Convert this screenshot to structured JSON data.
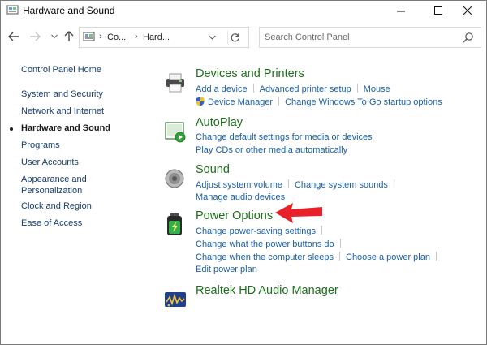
{
  "window": {
    "title": "Hardware and Sound"
  },
  "address": {
    "crumbs": [
      "Co...",
      "Hard..."
    ],
    "search_placeholder": "Search Control Panel"
  },
  "sidebar": {
    "items": [
      {
        "label": "Control Panel Home",
        "active": false
      },
      {
        "label": "System and Security",
        "active": false
      },
      {
        "label": "Network and Internet",
        "active": false
      },
      {
        "label": "Hardware and Sound",
        "active": true
      },
      {
        "label": "Programs",
        "active": false
      },
      {
        "label": "User Accounts",
        "active": false
      },
      {
        "label": "Appearance and",
        "label2": "Personalization",
        "active": false
      },
      {
        "label": "Clock and Region",
        "active": false
      },
      {
        "label": "Ease of Access",
        "active": false
      }
    ]
  },
  "sections": {
    "devices": {
      "title": "Devices and Printers",
      "links": [
        "Add a device",
        "Advanced printer setup",
        "Mouse",
        "Device Manager",
        "Change Windows To Go startup options"
      ]
    },
    "autoplay": {
      "title": "AutoPlay",
      "links": [
        "Change default settings for media or devices",
        "Play CDs or other media automatically"
      ]
    },
    "sound": {
      "title": "Sound",
      "links": [
        "Adjust system volume",
        "Change system sounds",
        "Manage audio devices"
      ]
    },
    "power": {
      "title": "Power Options",
      "links": [
        "Change power-saving settings",
        "Change what the power buttons do",
        "Change when the computer sleeps",
        "Choose a power plan",
        "Edit power plan"
      ]
    },
    "realtek": {
      "title": "Realtek HD Audio Manager"
    }
  },
  "colors": {
    "section_title": "#1c6e1c",
    "link": "#1a5fa8",
    "annotation_arrow": "#e8202a"
  },
  "icons": {
    "title": "control-panel-icon",
    "back": "back-arrow-icon",
    "forward": "forward-arrow-icon",
    "up": "up-arrow-icon",
    "refresh": "refresh-icon",
    "search": "search-icon"
  }
}
